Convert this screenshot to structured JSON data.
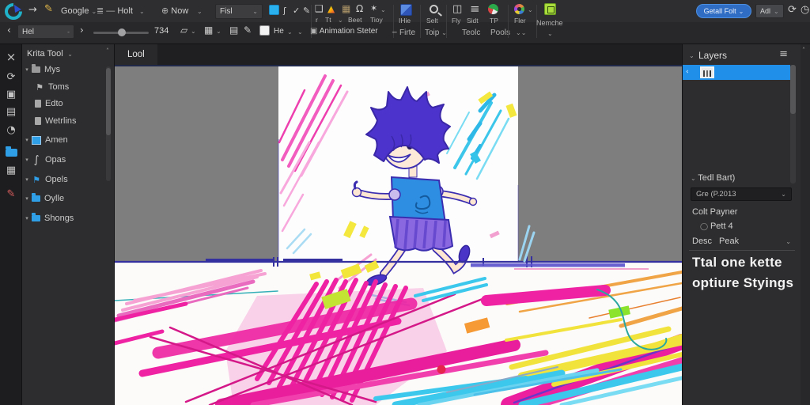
{
  "topbar": {
    "row1": {
      "google_label": "Google",
      "holt_label": "Holt",
      "now_label": "Now",
      "fisl_value": "Fisl",
      "cap_r": "r",
      "cap_tt": "Tt",
      "cap_beet": "Beet",
      "cap_tioy": "Tioy",
      "cap_ihie": "IHie",
      "cap_selt": "Selt",
      "cap_fly": "Fly",
      "cap_sidt": "Sidt",
      "cap_tp": "TP",
      "cap_fler": "Fler",
      "cap_nemche": "Nemche",
      "primary_button": "Getall Folt",
      "adl_value": "Adl"
    },
    "row2": {
      "hel_value": "Hel",
      "slider_value": "734",
      "he_value": "He",
      "animation_label": "Animation Steter",
      "firte_label": "Firte",
      "toip_label": "Toip",
      "teolc_label": "Teolc",
      "pools_label": "Pools"
    }
  },
  "left_panel": {
    "title": "Krita Tool",
    "items": [
      {
        "label": "Mys"
      },
      {
        "label": "Toms"
      },
      {
        "label": "Edto"
      },
      {
        "label": "Wetrlins"
      },
      {
        "label": "Amen"
      },
      {
        "label": "Opas"
      },
      {
        "label": "Opels"
      },
      {
        "label": "Oylle"
      },
      {
        "label": "Shongs"
      }
    ]
  },
  "canvas": {
    "tab_label": "Lool"
  },
  "right_panel": {
    "layers_title": "Layers",
    "tool_section_title": "Tedl Bart)",
    "tool_dropdown_value": "Gre (P.2013",
    "color_label": "Colt Payner",
    "radio_label": "Pett 4",
    "desc_label": "Desc",
    "desc_value": "Peak",
    "big_text_line1": "Ttal one kette",
    "big_text_line2": "optiure Styings"
  },
  "colors": {
    "selection_blue": "#1f8fea",
    "accent_cyan_swatch": "#2bb0ee",
    "canvas_gray": "#7e7e7e",
    "scribble_magenta": "#ee22a2",
    "scribble_cyan": "#3cc8ec",
    "scribble_yellow": "#f2e33c"
  }
}
